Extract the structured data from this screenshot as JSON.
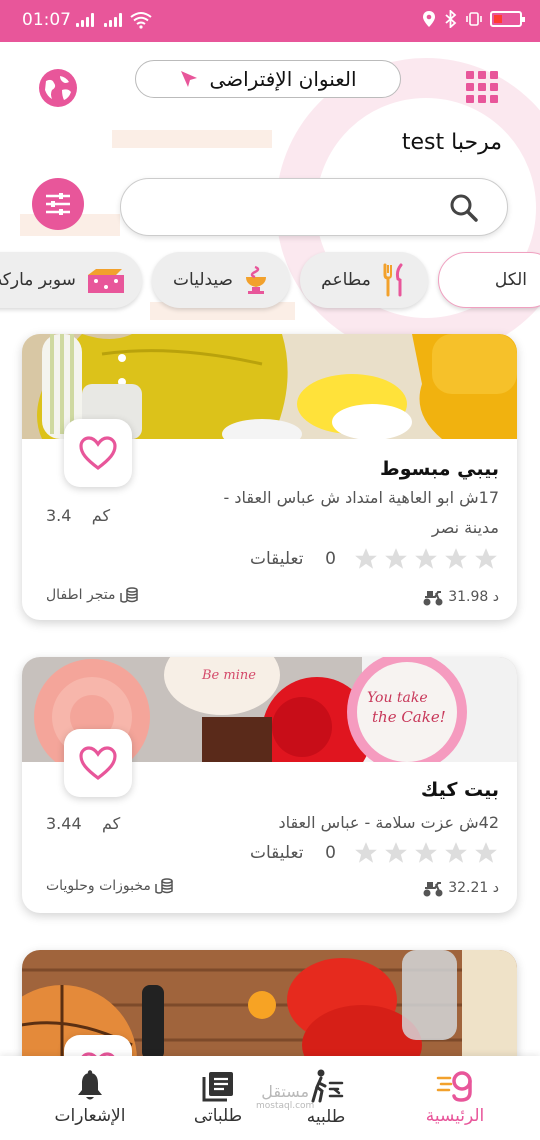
{
  "status_bar": {
    "time": "01:07"
  },
  "header": {
    "address_label": "العنوان الإفتراضى",
    "welcome": "مرحبا test"
  },
  "search": {
    "placeholder": ""
  },
  "categories": [
    {
      "label": "الكل",
      "icon": "all",
      "active": true
    },
    {
      "label": "مطاعم",
      "icon": "fork-knife-icon"
    },
    {
      "label": "صيدليات",
      "icon": "pharmacy-icon"
    },
    {
      "label": "سوبر ماركت",
      "icon": "supermarket-icon"
    }
  ],
  "stores": [
    {
      "name": "بيبي مبسوط",
      "address_line1": "17ش ابو العاهية امتداد ش عباس العقاد -",
      "address_line2": "مدينة نصر",
      "distance": "3.4",
      "distance_unit": "كم",
      "reviews_count": "0",
      "reviews_label": "تعليقات",
      "rating": 0,
      "delivery_fee": "31.98 د",
      "store_type": "متجر اطفال"
    },
    {
      "name": "بيت كيك",
      "address_line1": "42ش عزت سلامة - عباس العقاد",
      "distance": "3.44",
      "distance_unit": "كم",
      "reviews_count": "0",
      "reviews_label": "تعليقات",
      "rating": 0,
      "delivery_fee": "32.21 د",
      "store_type": "مخبوزات وحلويات"
    }
  ],
  "bottom_nav": [
    {
      "label": "الرئيسية",
      "icon": "home-logo-icon",
      "active": true
    },
    {
      "label": "طلبيه",
      "icon": "courier-icon"
    },
    {
      "label": "طلباتى",
      "icon": "orders-icon"
    },
    {
      "label": "الإشعارات",
      "icon": "bell-icon"
    }
  ],
  "watermark": {
    "text": "مستقل",
    "sub": "mostaql.com"
  },
  "colors": {
    "accent": "#e8569a",
    "background": "#ffffff"
  }
}
